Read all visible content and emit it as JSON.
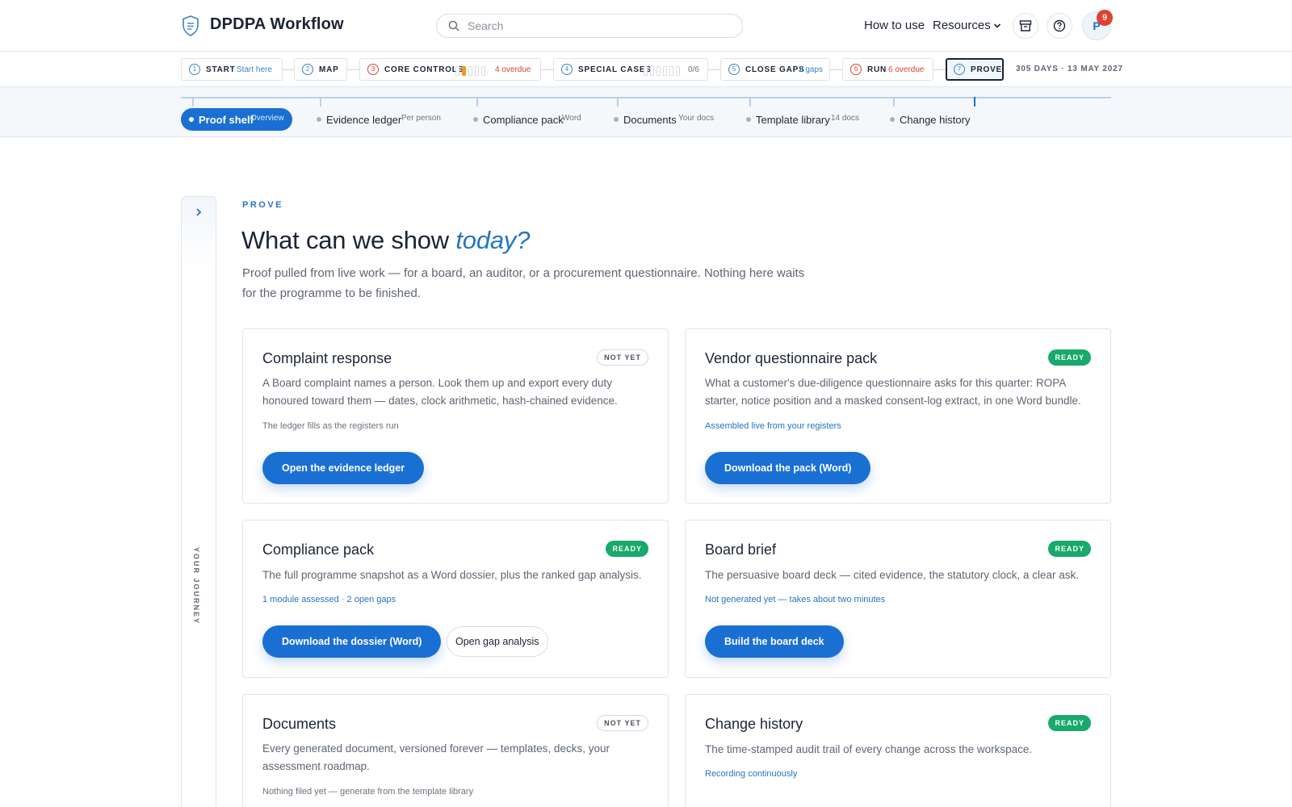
{
  "header": {
    "app_title": "DPDPA Workflow",
    "search_placeholder": "Search",
    "nav": {
      "how_to_use": "How to use",
      "resources": "Resources"
    },
    "avatar_initial": "P",
    "notification_count": "9"
  },
  "steps": [
    {
      "num": "1",
      "name": "START",
      "meta": "Start here"
    },
    {
      "num": "2",
      "name": "MAP",
      "meta": ""
    },
    {
      "num": "3",
      "name": "CORE CONTROLS",
      "meta": "4 overdue"
    },
    {
      "num": "4",
      "name": "SPECIAL CASES",
      "meta": "0/6"
    },
    {
      "num": "5",
      "name": "CLOSE GAPS",
      "meta": "2 gaps"
    },
    {
      "num": "6",
      "name": "RUN",
      "meta": "6 overdue"
    },
    {
      "num": "7",
      "name": "PROVE",
      "meta": ""
    }
  ],
  "deadline": "305 DAYS · 13 MAY 2027",
  "subtabs": [
    {
      "label": "Proof shelf",
      "hint": "Overview"
    },
    {
      "label": "Evidence ledger",
      "hint": "Per person"
    },
    {
      "label": "Compliance pack",
      "hint": "Word"
    },
    {
      "label": "Documents",
      "hint": "Your docs"
    },
    {
      "label": "Template library",
      "hint": "14 docs"
    },
    {
      "label": "Change history",
      "hint": ""
    }
  ],
  "rail_label": "YOUR JOURNEY",
  "hero": {
    "eyebrow": "PROVE",
    "title_plain": "What can we show ",
    "title_emph": "today?",
    "subtitle": "Proof pulled from live work — for a board, an auditor, or a procurement questionnaire. Nothing here waits for the programme to be finished."
  },
  "cards": [
    {
      "title": "Complaint response",
      "status": "NOT YET",
      "desc": "A Board complaint names a person. Look them up and export every duty honoured toward them — dates, clock arithmetic, hash-chained evidence.",
      "note": "The ledger fills as the registers run",
      "primary": "Open the evidence ledger"
    },
    {
      "title": "Vendor questionnaire pack",
      "status": "READY",
      "desc": "What a customer's due-diligence questionnaire asks for this quarter: ROPA starter, notice position and a masked consent-log extract, in one Word bundle.",
      "note": "Assembled live from your registers",
      "primary": "Download the pack (Word)"
    },
    {
      "title": "Compliance pack",
      "status": "READY",
      "desc": "The full programme snapshot as a Word dossier, plus the ranked gap analysis.",
      "note": "1 module assessed · 2 open gaps",
      "primary": "Download the dossier (Word)",
      "secondary": "Open gap analysis"
    },
    {
      "title": "Board brief",
      "status": "READY",
      "desc": "The persuasive board deck — cited evidence, the statutory clock, a clear ask.",
      "note": "Not generated yet — takes about two minutes",
      "primary": "Build the board deck"
    },
    {
      "title": "Documents",
      "status": "NOT YET",
      "desc": "Every generated document, versioned forever — templates, decks, your assessment roadmap.",
      "note": "Nothing filed yet — generate from the template library"
    },
    {
      "title": "Change history",
      "status": "READY",
      "desc": "The time-stamped audit trail of every change across the workspace.",
      "note": "Recording continuously"
    }
  ],
  "colors": {
    "accent": "#1a6fd3",
    "ready": "#19a96b",
    "overdue": "#d9442f",
    "progress": "#f39a1e"
  }
}
